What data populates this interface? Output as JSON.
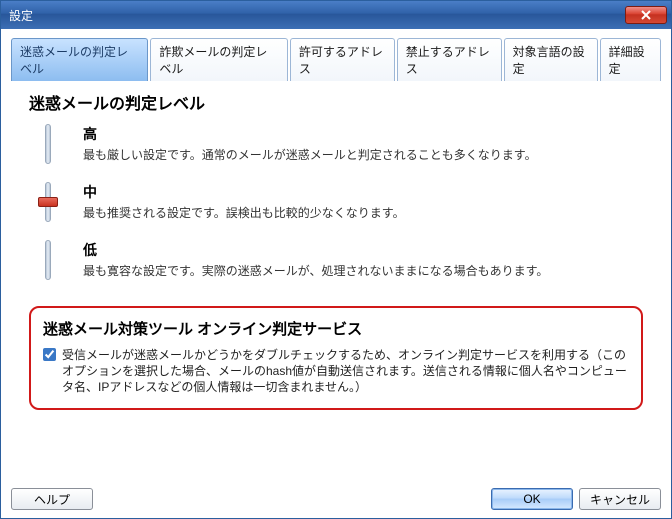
{
  "window": {
    "title": "設定"
  },
  "tabs": [
    {
      "label": "迷惑メールの判定レベル",
      "active": true
    },
    {
      "label": "詐欺メールの判定レベル"
    },
    {
      "label": "許可するアドレス"
    },
    {
      "label": "禁止するアドレス"
    },
    {
      "label": "対象言語の設定"
    },
    {
      "label": "詳細設定"
    }
  ],
  "panel": {
    "title": "迷惑メールの判定レベル",
    "levels": {
      "high": {
        "label": "高",
        "desc": "最も厳しい設定です。通常のメールが迷惑メールと判定されることも多くなります。"
      },
      "mid": {
        "label": "中",
        "desc": "最も推奨される設定です。誤検出も比較的少なくなります。"
      },
      "low": {
        "label": "低",
        "desc": "最も寛容な設定です。実際の迷惑メールが、処理されないままになる場合もあります。"
      }
    },
    "selected": "mid"
  },
  "online_service": {
    "title": "迷惑メール対策ツール  オンライン判定サービス",
    "checked": true,
    "label": "受信メールが迷惑メールかどうかをダブルチェックするため、オンライン判定サービスを利用する（このオプションを選択した場合、メールのhash値が自動送信されます。送信される情報に個人名やコンピュータ名、IPアドレスなどの個人情報は一切含まれません。）"
  },
  "buttons": {
    "help": "ヘルプ",
    "ok": "OK",
    "cancel": "キャンセル"
  }
}
